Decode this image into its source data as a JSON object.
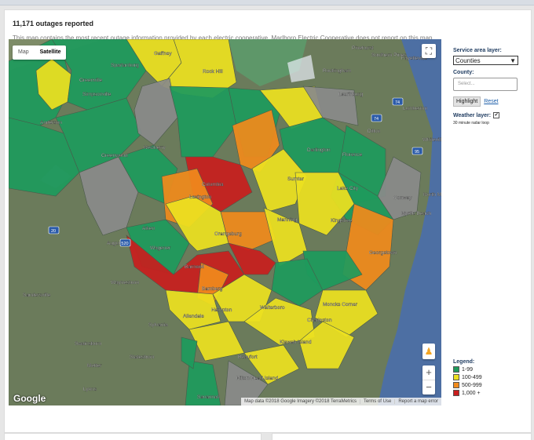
{
  "header": {
    "title": "11,171 outages reported",
    "subtitle": "This map contains the most recent outage information provided by each electric cooperative. Marlboro Electric Cooperative does not report on this map."
  },
  "map_controls": {
    "map_label": "Map",
    "satellite_label": "Satellite",
    "google_logo": "Google",
    "attribution": [
      "Map data ©2018 Google Imagery ©2018 TerraMetrics",
      "Terms of Use",
      "Report a map error"
    ],
    "zoom_in": "+",
    "zoom_out": "−",
    "icons": {
      "fullscreen": "fullscreen-icon",
      "pegman": "pegman-icon"
    }
  },
  "place_labels": [
    {
      "text": "Pinehurst"
    },
    {
      "text": "Southern Pines"
    },
    {
      "text": "Fayetteville"
    },
    {
      "text": "Rockingham"
    },
    {
      "text": "Laurinburg"
    },
    {
      "text": "Lumberton"
    },
    {
      "text": "Dillon"
    },
    {
      "text": "Whiteville"
    },
    {
      "text": "Conway"
    },
    {
      "text": "North Myrtle Beach"
    },
    {
      "text": "Myrtle Beach"
    },
    {
      "text": "Newberry"
    },
    {
      "text": "Greenwood"
    },
    {
      "text": "Augusta"
    },
    {
      "text": "Waynesboro"
    },
    {
      "text": "Sandersville"
    },
    {
      "text": "Swainsboro"
    },
    {
      "text": "Metter"
    },
    {
      "text": "Statesboro"
    },
    {
      "text": "Sylvania"
    },
    {
      "text": "Beaufort"
    },
    {
      "text": "Hilton Head Island"
    },
    {
      "text": "Savannah"
    },
    {
      "text": "Lyons"
    },
    {
      "text": "Columbia"
    },
    {
      "text": "Lexington"
    },
    {
      "text": "Aiken"
    },
    {
      "text": "Orangeburg"
    },
    {
      "text": "Charleston"
    },
    {
      "text": "Georgetown"
    },
    {
      "text": "Kingstree"
    },
    {
      "text": "Sumter"
    },
    {
      "text": "Manning"
    },
    {
      "text": "Florence"
    },
    {
      "text": "Darlington"
    },
    {
      "text": "Lake City"
    },
    {
      "text": "Walterboro"
    },
    {
      "text": "Kiawah Island"
    },
    {
      "text": "Moncks Corner"
    },
    {
      "text": "Anderson"
    },
    {
      "text": "Greenville"
    },
    {
      "text": "Spartanburg"
    },
    {
      "text": "Simpsonville"
    },
    {
      "text": "Gaffney"
    },
    {
      "text": "Rock Hill"
    },
    {
      "text": "Barnwell"
    },
    {
      "text": "Allendale"
    },
    {
      "text": "Hampton"
    },
    {
      "text": "Wagener"
    },
    {
      "text": "Bamberg"
    }
  ],
  "route_shields": [
    "74",
    "20",
    "520",
    "74",
    "95"
  ],
  "sidebar": {
    "service_area_label": "Service area layer:",
    "service_area_value": "Counties",
    "county_label": "County:",
    "county_placeholder": "Select...",
    "highlight_label": "Highlight",
    "reset_label": "Reset",
    "weather_label": "Weather layer:",
    "weather_checked": "✔",
    "weather_note": "30 minute radar loop"
  },
  "legend": {
    "title": "Legend:",
    "items": [
      {
        "label": "1-99",
        "color": "#1e9a5c"
      },
      {
        "label": "100-499",
        "color": "#ece020"
      },
      {
        "label": "500-999",
        "color": "#f08a1c"
      },
      {
        "label": "1,000 +",
        "color": "#c81e1e"
      }
    ]
  },
  "colors": {
    "no_report": "#8a8a8a",
    "water": "#4d6fa3",
    "land": "#6f7f5e"
  }
}
